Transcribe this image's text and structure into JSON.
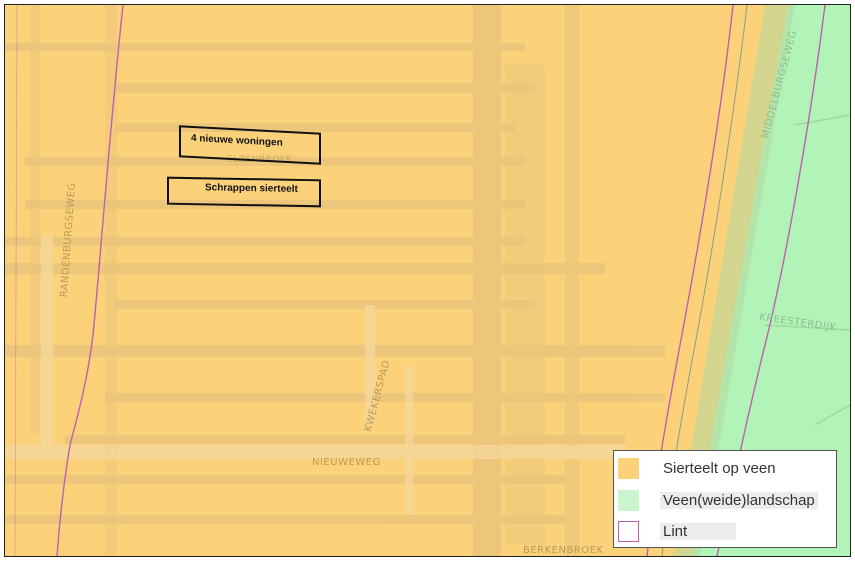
{
  "map": {
    "annotations": {
      "new_homes": "4 nieuwe woningen",
      "remove_horticulture": "Schrappen sierteelt"
    },
    "streets": {
      "randenburgseweg": "RANDENBURGSEWEG",
      "kwekerspad": "KWEKERSPAD",
      "nieuweweg": "NIEUWEWEG",
      "berkenbroek": "BERKENBROEK",
      "kreesterdijk": "KREESTERDIJK",
      "middelburgseweg": "MIDDELBURGSEWEG",
      "elzenbroek": "ELZENBROEK"
    },
    "colors": {
      "sierteelt": "#fbd27a",
      "veen": "#b2f4b8",
      "lint": "#c05fae"
    }
  },
  "legend": {
    "items": [
      {
        "label": "Sierteelt op veen",
        "swatch": "fill-orange"
      },
      {
        "label": "Veen(weide)landschap",
        "swatch": "fill-green"
      },
      {
        "label": "Lint",
        "swatch": "outline-purple"
      }
    ]
  }
}
